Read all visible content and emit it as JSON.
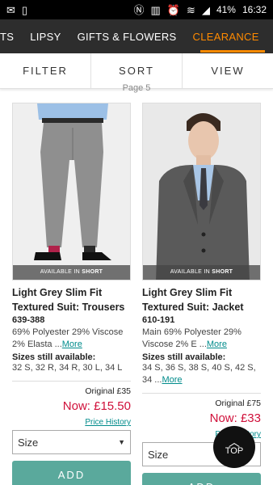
{
  "statusbar": {
    "left_icons": [
      "gmail-icon",
      "phone-icon"
    ],
    "right_icons": [
      "nfc-icon",
      "vibrate-icon",
      "alarm-icon",
      "wifi-icon",
      "signal-icon"
    ],
    "battery": "41%",
    "time": "16:32"
  },
  "nav": {
    "items": [
      "TS",
      "LIPSY",
      "GIFTS & FLOWERS",
      "CLEARANCE"
    ],
    "active": "CLEARANCE",
    "active_color": "#ff8a00"
  },
  "controls": {
    "filter": "FILTER",
    "sort": "SORT",
    "view": "VIEW"
  },
  "page_label": "Page 5",
  "products": [
    {
      "badge_prefix": "AVAILABLE IN",
      "badge_fit": "SHORT",
      "title": "Light Grey Slim Fit Textured Suit: Trousers",
      "code": "639-388",
      "desc": "69% Polyester 29% Viscose 2% Elasta ...",
      "more": "More",
      "sizes_heading": "Sizes still available:",
      "sizes": "32 S, 32 R, 34 R, 30 L, 34 L",
      "original": "Original £35",
      "now": "Now: £15.50",
      "history": "Price History",
      "size_select": "Size",
      "add": "ADD"
    },
    {
      "badge_prefix": "AVAILABLE IN",
      "badge_fit": "SHORT",
      "title": "Light Grey Slim Fit Textured Suit: Jacket",
      "code": "610-191",
      "desc": "Main 69% Polyester 29% Viscose 2% E ...",
      "more": "More",
      "sizes_heading": "Sizes still available:",
      "sizes": "34 S, 36 S, 38 S, 40 S, 42 S, 34 ...",
      "sizes_more": "More",
      "original": "Original £75",
      "now": "Now: £33",
      "history": "Price History",
      "size_select": "Size",
      "add": "ADD"
    }
  ],
  "top_button": "TOP"
}
